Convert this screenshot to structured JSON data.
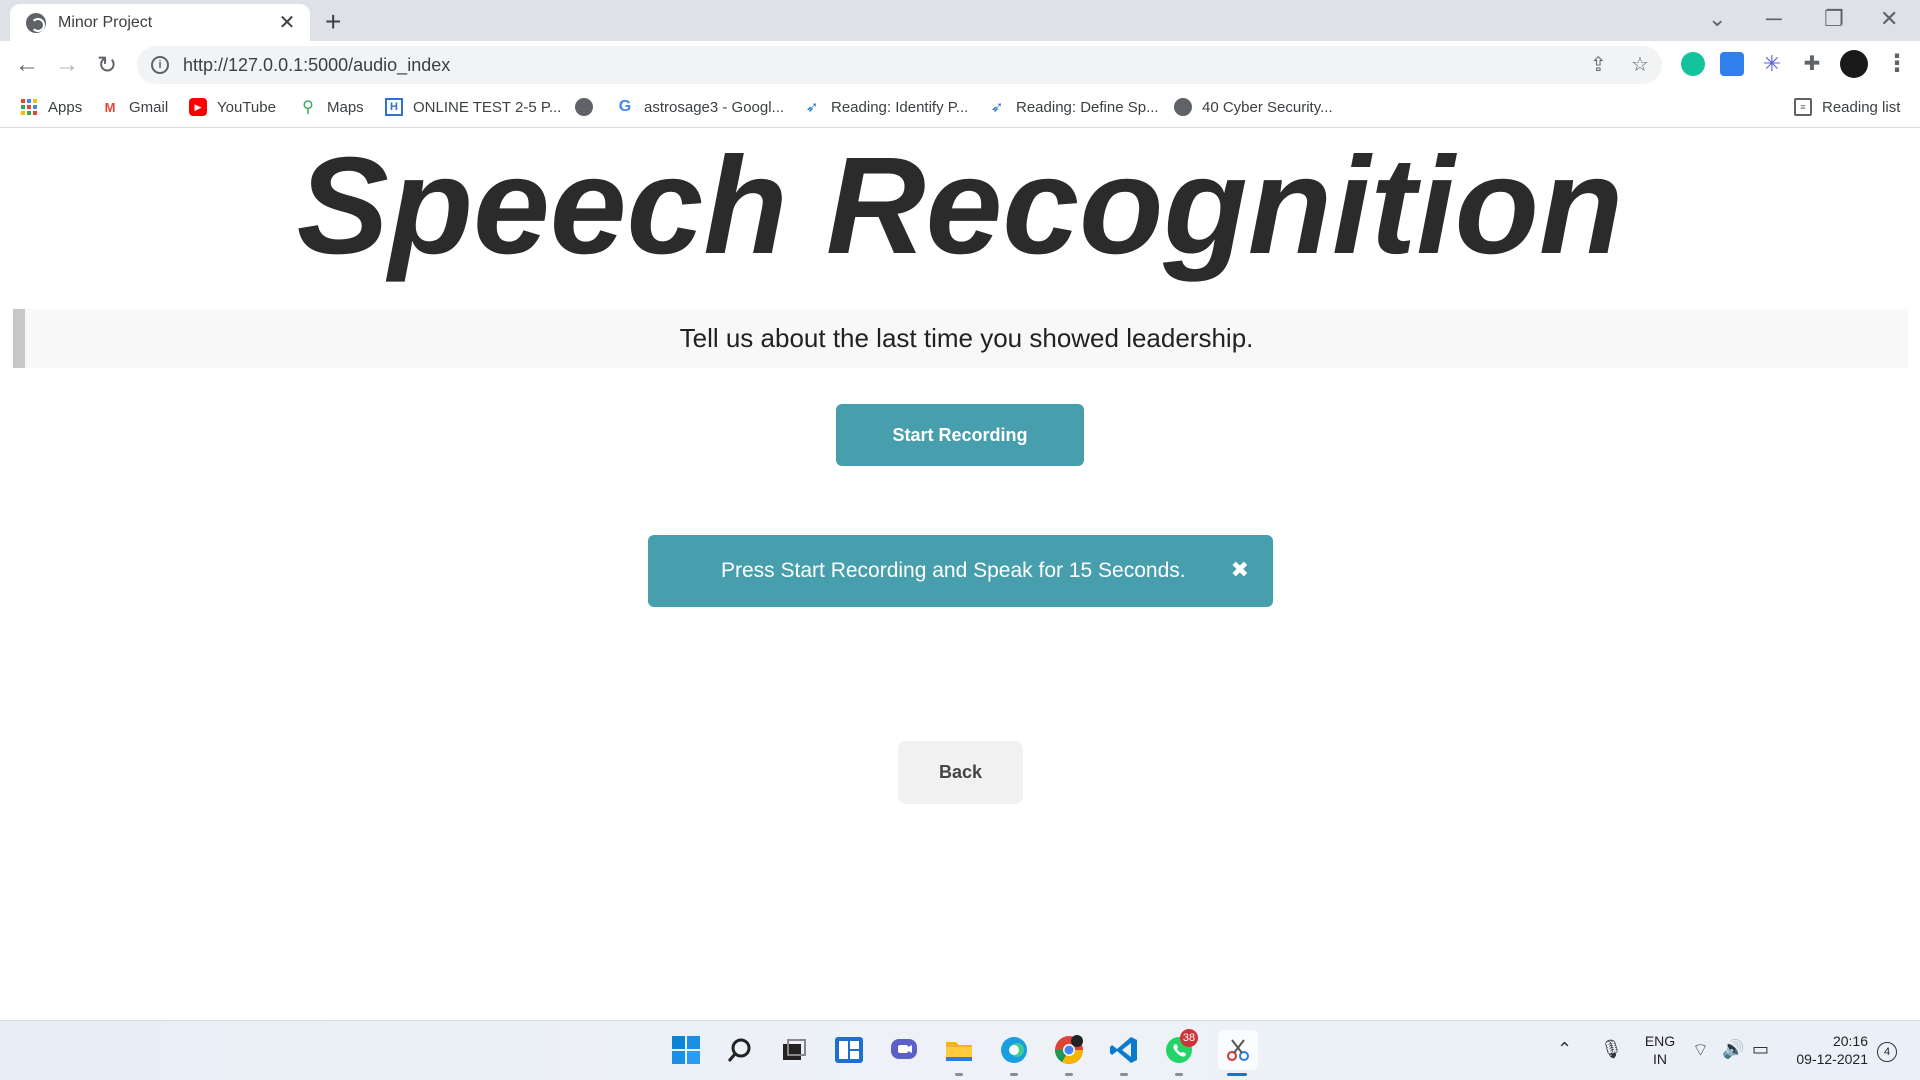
{
  "browser": {
    "tab": {
      "title": "Minor Project",
      "close": "✕"
    },
    "new_tab": "+",
    "window_controls": {
      "dropdown": "⌄",
      "minimize": "─",
      "restore": "❐",
      "close": "✕"
    },
    "nav": {
      "back": "←",
      "forward": "→",
      "reload": "↻"
    },
    "url": "http://127.0.0.1:5000/audio_index",
    "menu": "⋮"
  },
  "bookmarks": {
    "items": [
      {
        "label": "Apps",
        "icon": "apps-grid"
      },
      {
        "label": "Gmail",
        "icon": "gmail"
      },
      {
        "label": "YouTube",
        "icon": "youtube"
      },
      {
        "label": "Maps",
        "icon": "maps-pin"
      },
      {
        "label": "ONLINE TEST 2-5 P...",
        "icon": "h-logo"
      },
      {
        "label": "",
        "icon": "globe"
      },
      {
        "label": "astrosage3 - Googl...",
        "icon": "google"
      },
      {
        "label": "Reading: Identify P...",
        "icon": "reading"
      },
      {
        "label": "Reading: Define Sp...",
        "icon": "reading"
      },
      {
        "label": "40 Cyber Security...",
        "icon": "globe"
      }
    ],
    "reading_list": "Reading list"
  },
  "page": {
    "heading": "Speech Recognition",
    "question": "Tell us about the last time you showed leadership.",
    "start_button": "Start Recording",
    "alert": {
      "message": "Press Start Recording and Speak for 15 Seconds.",
      "close": "✖"
    },
    "back_button": "Back"
  },
  "taskbar": {
    "whatsapp_badge": "38",
    "tray": {
      "lang_line1": "ENG",
      "lang_line2": "IN",
      "time": "20:16",
      "date": "09-12-2021",
      "notifications": "4"
    }
  },
  "colors": {
    "accent": "#479fae",
    "heading": "#2b2b2b",
    "question_bg": "#f8f8f8",
    "back_bg": "#f1f1f1"
  }
}
